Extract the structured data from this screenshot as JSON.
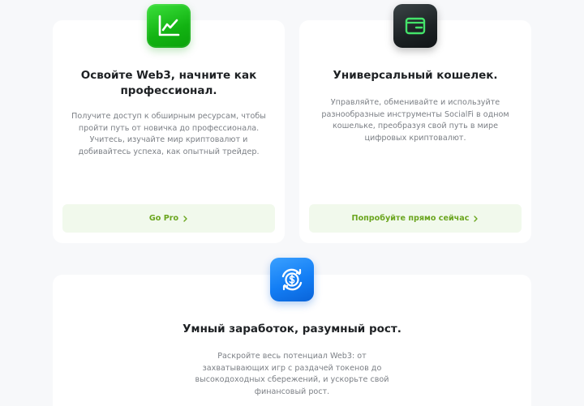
{
  "cards": [
    {
      "title": "Освойте Web3, начните как профессионал.",
      "description": "Получите доступ к обширным ресурсам, чтобы пройти путь от новичка до профессионала. Учитесь, изучайте мир криптовалют и добивайтесь успеха, как опытный трейдер.",
      "cta_label": "Go Pro",
      "icon": "chart-line-icon"
    },
    {
      "title": "Универсальный кошелек.",
      "description": "Управляйте, обменивайте и используйте разнообразные инструменты SocialFi в одном кошельке, преобразуя свой путь в мире цифровых криптовалют.",
      "cta_label": "Попробуйте прямо сейчас",
      "icon": "wallet-icon"
    },
    {
      "title": "Умный заработок, разумный рост.",
      "description": "Раскройте весь потенциал Web3: от захватывающих игр с раздачей токенов до высокодоходных сбережений, и ускорьте свой финансовый рост.",
      "icon": "dollar-cycle-icon"
    }
  ],
  "colors": {
    "accent_green": "#6aa51e",
    "cta_background": "#f1f9ec",
    "page_background": "#f7f8fa"
  }
}
